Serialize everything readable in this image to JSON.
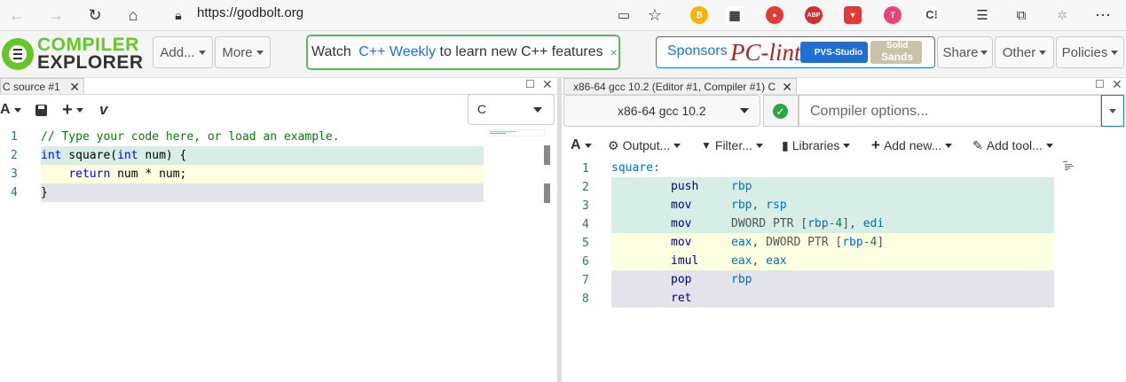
{
  "browser": {
    "url": "https://godbolt.org"
  },
  "header": {
    "logo_line1": "COMPILER",
    "logo_line2": "EXPLORER",
    "add_label": "Add...",
    "more_label": "More",
    "motd_prefix": "Watch ",
    "motd_link": "C++ Weekly",
    "motd_suffix": " to learn new C++ features",
    "motd_close": "×",
    "sponsors_label": "Sponsors",
    "sponsor_pclint": "PC-lint",
    "sponsor_pvs": "PVS-Studio",
    "sponsor_solid1": "Solid",
    "sponsor_solid2": "Sands",
    "share_label": "Share",
    "other_label": "Other",
    "policies_label": "Policies"
  },
  "editor": {
    "tab_title": "C source #1",
    "language": "C",
    "lines": [
      {
        "n": "1",
        "text": "// Type your code here, or load an example."
      },
      {
        "n": "2",
        "text": "int square(int num) {"
      },
      {
        "n": "3",
        "text": "    return num * num;"
      },
      {
        "n": "4",
        "text": "}"
      }
    ]
  },
  "compiler": {
    "tab_title": "x86-64 gcc 10.2 (Editor #1, Compiler #1) C",
    "compiler_name": "x86-64 gcc 10.2",
    "options_placeholder": "Compiler options...",
    "toolbar": {
      "output": "Output...",
      "filter": "Filter...",
      "libraries": "Libraries",
      "add_new": "Add new...",
      "add_tool": "Add tool..."
    },
    "asm": [
      {
        "n": "1",
        "op": "square:",
        "args": ""
      },
      {
        "n": "2",
        "op": "push",
        "args": "rbp"
      },
      {
        "n": "3",
        "op": "mov",
        "args": "rbp, rsp"
      },
      {
        "n": "4",
        "op": "mov",
        "args": "DWORD PTR [rbp-4], edi"
      },
      {
        "n": "5",
        "op": "mov",
        "args": "eax, DWORD PTR [rbp-4]"
      },
      {
        "n": "6",
        "op": "imul",
        "args": "eax, eax"
      },
      {
        "n": "7",
        "op": "pop",
        "args": "rbp"
      },
      {
        "n": "8",
        "op": "ret",
        "args": ""
      }
    ]
  },
  "colors": {
    "highlight_green": "#d6eee6",
    "highlight_yellow": "#fdfde0",
    "highlight_purple": "#e3e3ec",
    "accent_green": "#5cb85c",
    "link_blue": "#1a73e8"
  }
}
